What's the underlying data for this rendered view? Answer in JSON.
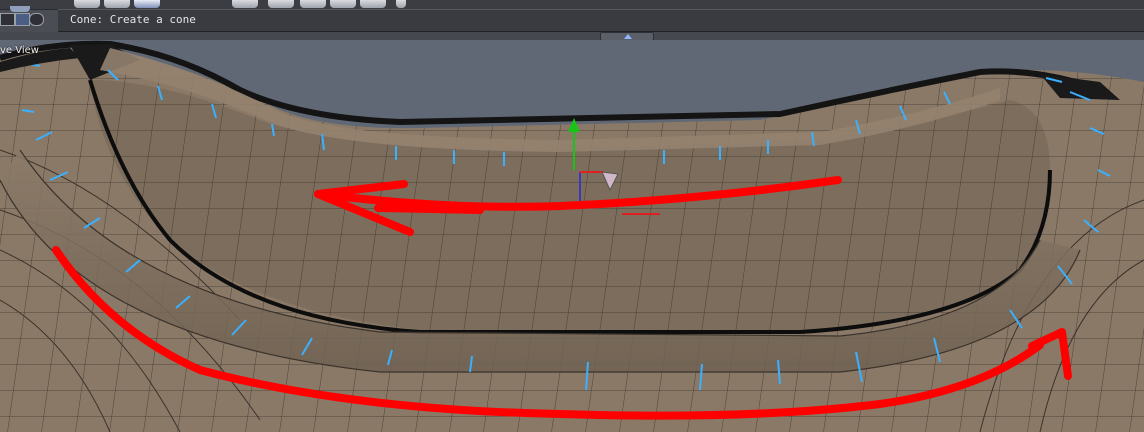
{
  "status": {
    "text": "Cone: Create a cone"
  },
  "viewport": {
    "label": "ve View"
  },
  "colors": {
    "background": "#616875",
    "surface": "#8a7866",
    "wire": "#3a332c",
    "edge_marks": "#3ab0ff",
    "annotation": "#ff0000",
    "gizmo_y": "#18c418",
    "gizmo_x": "#e02020"
  },
  "icons": [
    "sphere-icon",
    "cylinder-icon",
    "cone-icon",
    "cube-icon",
    "plane-icon",
    "settings-icon"
  ]
}
